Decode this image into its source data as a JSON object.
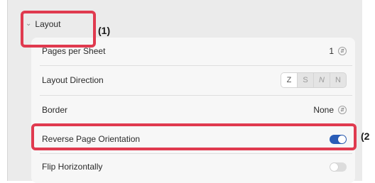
{
  "section": {
    "title": "Layout",
    "chevron_icon": "chevron-down-icon"
  },
  "rows": {
    "pages_per_sheet": {
      "label": "Pages per Sheet",
      "value": "1"
    },
    "layout_direction": {
      "label": "Layout Direction",
      "options": [
        "Z",
        "S",
        "N",
        "N"
      ]
    },
    "border": {
      "label": "Border",
      "value": "None"
    },
    "reverse_orientation": {
      "label": "Reverse Page Orientation",
      "state": "on"
    },
    "flip_horizontally": {
      "label": "Flip Horizontally",
      "state": "off"
    }
  },
  "callouts": {
    "one": "(1)",
    "two": "(2"
  },
  "colors": {
    "accent": "#2a5db7",
    "callout": "#e03a4f"
  }
}
